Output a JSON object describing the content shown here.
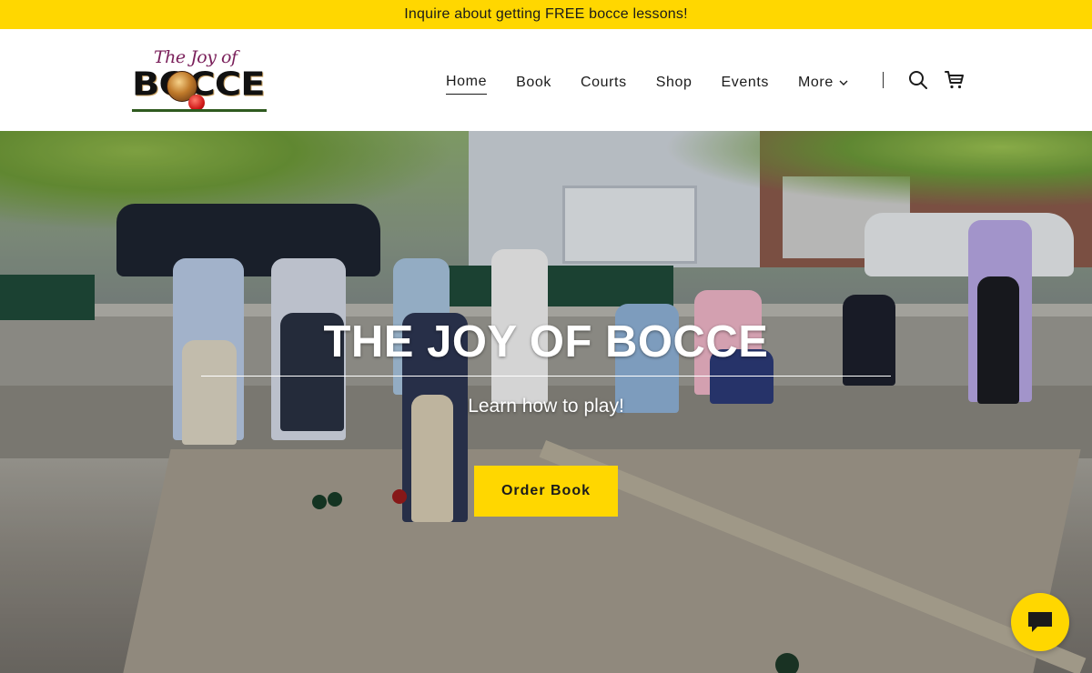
{
  "announcement": {
    "text": "Inquire about getting FREE bocce lessons!"
  },
  "header": {
    "logo": {
      "script_text": "The Joy of",
      "main_text": "BOCCE"
    },
    "nav": [
      {
        "label": "Home",
        "active": true
      },
      {
        "label": "Book",
        "active": false
      },
      {
        "label": "Courts",
        "active": false
      },
      {
        "label": "Shop",
        "active": false
      },
      {
        "label": "Events",
        "active": false
      },
      {
        "label": "More",
        "active": false,
        "has_dropdown": true
      }
    ],
    "icons": [
      "search-icon",
      "cart-icon"
    ]
  },
  "hero": {
    "title": "THE JOY OF BOCCE",
    "subtitle": "Learn how to play!",
    "cta_label": "Order Book"
  },
  "chat": {
    "icon": "chat-icon"
  },
  "colors": {
    "accent": "#ffd700",
    "text": "#1b1b1b",
    "background": "#ffffff"
  }
}
